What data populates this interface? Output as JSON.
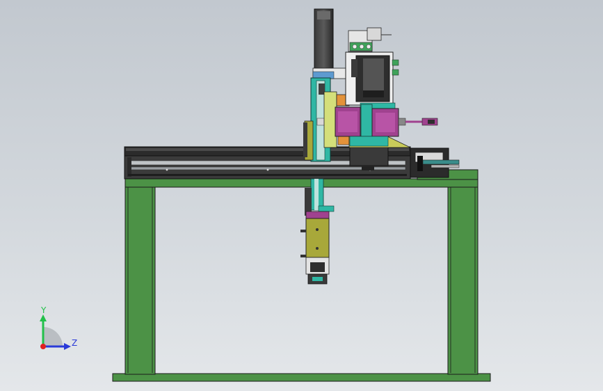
{
  "viewport": {
    "background_top": "#c2c8cf",
    "background_bottom": "#e4e7ea"
  },
  "model": {
    "frame_color": "#4c9246",
    "rail_color": "#2b2b2b",
    "teal_color": "#2fb7a4",
    "purple_color": "#a0428f",
    "olive_color": "#a8a83a",
    "orange_color": "#e3923a"
  },
  "triad": {
    "y_label": "Y",
    "z_label": "Z",
    "y_color": "#22c04a",
    "z_color": "#2a3ad8",
    "origin_color": "#e02020"
  }
}
